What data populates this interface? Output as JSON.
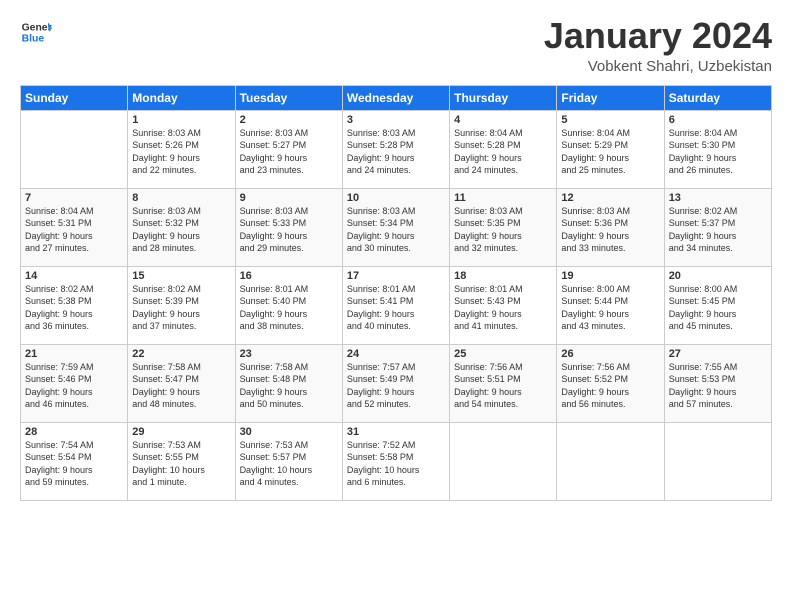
{
  "logo": {
    "line1": "General",
    "line2": "Blue"
  },
  "title": "January 2024",
  "subtitle": "Vobkent Shahri, Uzbekistan",
  "days_header": [
    "Sunday",
    "Monday",
    "Tuesday",
    "Wednesday",
    "Thursday",
    "Friday",
    "Saturday"
  ],
  "weeks": [
    [
      {
        "num": "",
        "info": ""
      },
      {
        "num": "1",
        "info": "Sunrise: 8:03 AM\nSunset: 5:26 PM\nDaylight: 9 hours\nand 22 minutes."
      },
      {
        "num": "2",
        "info": "Sunrise: 8:03 AM\nSunset: 5:27 PM\nDaylight: 9 hours\nand 23 minutes."
      },
      {
        "num": "3",
        "info": "Sunrise: 8:03 AM\nSunset: 5:28 PM\nDaylight: 9 hours\nand 24 minutes."
      },
      {
        "num": "4",
        "info": "Sunrise: 8:04 AM\nSunset: 5:28 PM\nDaylight: 9 hours\nand 24 minutes."
      },
      {
        "num": "5",
        "info": "Sunrise: 8:04 AM\nSunset: 5:29 PM\nDaylight: 9 hours\nand 25 minutes."
      },
      {
        "num": "6",
        "info": "Sunrise: 8:04 AM\nSunset: 5:30 PM\nDaylight: 9 hours\nand 26 minutes."
      }
    ],
    [
      {
        "num": "7",
        "info": "Sunrise: 8:04 AM\nSunset: 5:31 PM\nDaylight: 9 hours\nand 27 minutes."
      },
      {
        "num": "8",
        "info": "Sunrise: 8:03 AM\nSunset: 5:32 PM\nDaylight: 9 hours\nand 28 minutes."
      },
      {
        "num": "9",
        "info": "Sunrise: 8:03 AM\nSunset: 5:33 PM\nDaylight: 9 hours\nand 29 minutes."
      },
      {
        "num": "10",
        "info": "Sunrise: 8:03 AM\nSunset: 5:34 PM\nDaylight: 9 hours\nand 30 minutes."
      },
      {
        "num": "11",
        "info": "Sunrise: 8:03 AM\nSunset: 5:35 PM\nDaylight: 9 hours\nand 32 minutes."
      },
      {
        "num": "12",
        "info": "Sunrise: 8:03 AM\nSunset: 5:36 PM\nDaylight: 9 hours\nand 33 minutes."
      },
      {
        "num": "13",
        "info": "Sunrise: 8:02 AM\nSunset: 5:37 PM\nDaylight: 9 hours\nand 34 minutes."
      }
    ],
    [
      {
        "num": "14",
        "info": "Sunrise: 8:02 AM\nSunset: 5:38 PM\nDaylight: 9 hours\nand 36 minutes."
      },
      {
        "num": "15",
        "info": "Sunrise: 8:02 AM\nSunset: 5:39 PM\nDaylight: 9 hours\nand 37 minutes."
      },
      {
        "num": "16",
        "info": "Sunrise: 8:01 AM\nSunset: 5:40 PM\nDaylight: 9 hours\nand 38 minutes."
      },
      {
        "num": "17",
        "info": "Sunrise: 8:01 AM\nSunset: 5:41 PM\nDaylight: 9 hours\nand 40 minutes."
      },
      {
        "num": "18",
        "info": "Sunrise: 8:01 AM\nSunset: 5:43 PM\nDaylight: 9 hours\nand 41 minutes."
      },
      {
        "num": "19",
        "info": "Sunrise: 8:00 AM\nSunset: 5:44 PM\nDaylight: 9 hours\nand 43 minutes."
      },
      {
        "num": "20",
        "info": "Sunrise: 8:00 AM\nSunset: 5:45 PM\nDaylight: 9 hours\nand 45 minutes."
      }
    ],
    [
      {
        "num": "21",
        "info": "Sunrise: 7:59 AM\nSunset: 5:46 PM\nDaylight: 9 hours\nand 46 minutes."
      },
      {
        "num": "22",
        "info": "Sunrise: 7:58 AM\nSunset: 5:47 PM\nDaylight: 9 hours\nand 48 minutes."
      },
      {
        "num": "23",
        "info": "Sunrise: 7:58 AM\nSunset: 5:48 PM\nDaylight: 9 hours\nand 50 minutes."
      },
      {
        "num": "24",
        "info": "Sunrise: 7:57 AM\nSunset: 5:49 PM\nDaylight: 9 hours\nand 52 minutes."
      },
      {
        "num": "25",
        "info": "Sunrise: 7:56 AM\nSunset: 5:51 PM\nDaylight: 9 hours\nand 54 minutes."
      },
      {
        "num": "26",
        "info": "Sunrise: 7:56 AM\nSunset: 5:52 PM\nDaylight: 9 hours\nand 56 minutes."
      },
      {
        "num": "27",
        "info": "Sunrise: 7:55 AM\nSunset: 5:53 PM\nDaylight: 9 hours\nand 57 minutes."
      }
    ],
    [
      {
        "num": "28",
        "info": "Sunrise: 7:54 AM\nSunset: 5:54 PM\nDaylight: 9 hours\nand 59 minutes."
      },
      {
        "num": "29",
        "info": "Sunrise: 7:53 AM\nSunset: 5:55 PM\nDaylight: 10 hours\nand 1 minute."
      },
      {
        "num": "30",
        "info": "Sunrise: 7:53 AM\nSunset: 5:57 PM\nDaylight: 10 hours\nand 4 minutes."
      },
      {
        "num": "31",
        "info": "Sunrise: 7:52 AM\nSunset: 5:58 PM\nDaylight: 10 hours\nand 6 minutes."
      },
      {
        "num": "",
        "info": ""
      },
      {
        "num": "",
        "info": ""
      },
      {
        "num": "",
        "info": ""
      }
    ]
  ]
}
